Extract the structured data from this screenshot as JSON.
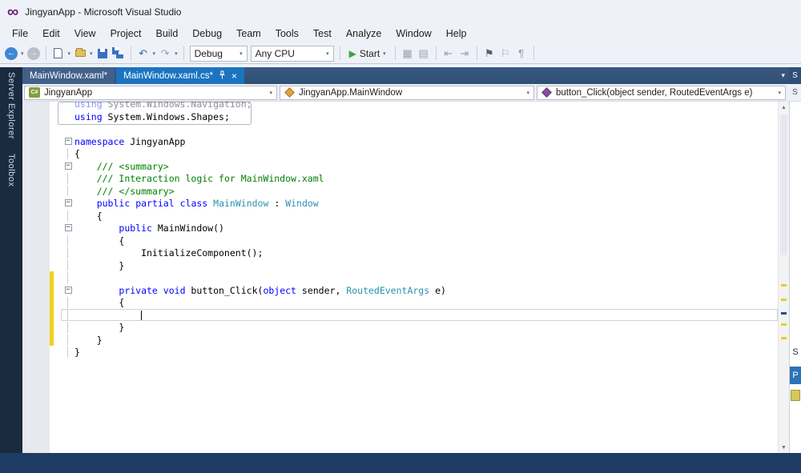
{
  "window": {
    "title": "JingyanApp - Microsoft Visual Studio"
  },
  "glyphs": {
    "logo": "∞",
    "dropdown": "▾",
    "back": "←",
    "forward": "→",
    "undo": "↶",
    "redo": "↷",
    "start_play": "▶",
    "close": "×",
    "fold_minus": "−",
    "up": "▲",
    "down": "▼",
    "grid": "▦",
    "lines": "▤",
    "outdent": "⇤",
    "indent": "⇥",
    "flag": "⚑",
    "flag_outline": "⚐",
    "pilcrow": "¶",
    "csharp": "C#"
  },
  "menu": {
    "items": [
      "File",
      "Edit",
      "View",
      "Project",
      "Build",
      "Debug",
      "Team",
      "Tools",
      "Test",
      "Analyze",
      "Window",
      "Help"
    ]
  },
  "toolbar": {
    "debug_config": "Debug",
    "platform": "Any CPU",
    "start_label": "Start"
  },
  "left_rail": {
    "tabs": [
      "Server Explorer",
      "Toolbox"
    ]
  },
  "tabs": {
    "items": [
      {
        "label": "MainWindow.xaml*"
      },
      {
        "label": "MainWindow.xaml.cs*"
      }
    ]
  },
  "navbar": {
    "project": "JingyanApp",
    "type_name": "JingyanApp.MainWindow",
    "member": "button_Click(object sender, RoutedEventArgs e)"
  },
  "right_rail": {
    "top": "S",
    "nav": "S",
    "body": "S",
    "properties": "P"
  },
  "editor": {
    "lines": [
      {
        "fold": "",
        "faded": true,
        "segs": [
          [
            "using",
            "k"
          ],
          [
            " System.Windows.Navigation;",
            "p"
          ]
        ]
      },
      {
        "fold": "",
        "segs": [
          [
            "using",
            "k"
          ],
          [
            " System.Windows.Shapes;",
            "p"
          ]
        ]
      },
      {
        "fold": "",
        "segs": []
      },
      {
        "fold": "minus",
        "segs": [
          [
            "namespace",
            "k"
          ],
          [
            " JingyanApp",
            "p"
          ]
        ]
      },
      {
        "fold": "bar",
        "segs": [
          [
            "{",
            "p"
          ]
        ]
      },
      {
        "fold": "minus",
        "segs": [
          [
            "    ",
            "p"
          ],
          [
            "/// <summary>",
            "c"
          ]
        ]
      },
      {
        "fold": "bar",
        "segs": [
          [
            "    ",
            "p"
          ],
          [
            "/// Interaction logic for MainWindow.xaml",
            "c"
          ]
        ]
      },
      {
        "fold": "bar",
        "segs": [
          [
            "    ",
            "p"
          ],
          [
            "/// </summary>",
            "c"
          ]
        ]
      },
      {
        "fold": "minus",
        "segs": [
          [
            "    ",
            "p"
          ],
          [
            "public",
            "k"
          ],
          [
            " ",
            "p"
          ],
          [
            "partial",
            "k"
          ],
          [
            " ",
            "p"
          ],
          [
            "class",
            "k"
          ],
          [
            " ",
            "p"
          ],
          [
            "MainWindow",
            "t"
          ],
          [
            " : ",
            "p"
          ],
          [
            "Window",
            "t"
          ]
        ]
      },
      {
        "fold": "bar",
        "segs": [
          [
            "    {",
            "p"
          ]
        ]
      },
      {
        "fold": "minus",
        "segs": [
          [
            "        ",
            "p"
          ],
          [
            "public",
            "k"
          ],
          [
            " MainWindow()",
            "p"
          ]
        ]
      },
      {
        "fold": "bar",
        "segs": [
          [
            "        {",
            "p"
          ]
        ]
      },
      {
        "fold": "bar",
        "segs": [
          [
            "            InitializeComponent();",
            "p"
          ]
        ]
      },
      {
        "fold": "bar",
        "segs": [
          [
            "        }",
            "p"
          ]
        ]
      },
      {
        "fold": "bar",
        "changed": true,
        "segs": []
      },
      {
        "fold": "minus",
        "changed": true,
        "segs": [
          [
            "        ",
            "p"
          ],
          [
            "private",
            "k"
          ],
          [
            " ",
            "p"
          ],
          [
            "void",
            "k"
          ],
          [
            " button_Click(",
            "p"
          ],
          [
            "object",
            "k"
          ],
          [
            " sender, ",
            "p"
          ],
          [
            "RoutedEventArgs",
            "t"
          ],
          [
            " e)",
            "p"
          ]
        ]
      },
      {
        "fold": "bar",
        "changed": true,
        "segs": [
          [
            "        {",
            "p"
          ]
        ]
      },
      {
        "fold": "bar",
        "changed": true,
        "current": true,
        "caret": true,
        "segs": [
          [
            "            ",
            "p"
          ]
        ]
      },
      {
        "fold": "bar",
        "changed": true,
        "segs": [
          [
            "        }",
            "p"
          ]
        ]
      },
      {
        "fold": "bar",
        "changed": true,
        "segs": [
          [
            "    }",
            "p"
          ]
        ]
      },
      {
        "fold": "bar",
        "segs": [
          [
            "}",
            "p"
          ]
        ]
      }
    ]
  }
}
